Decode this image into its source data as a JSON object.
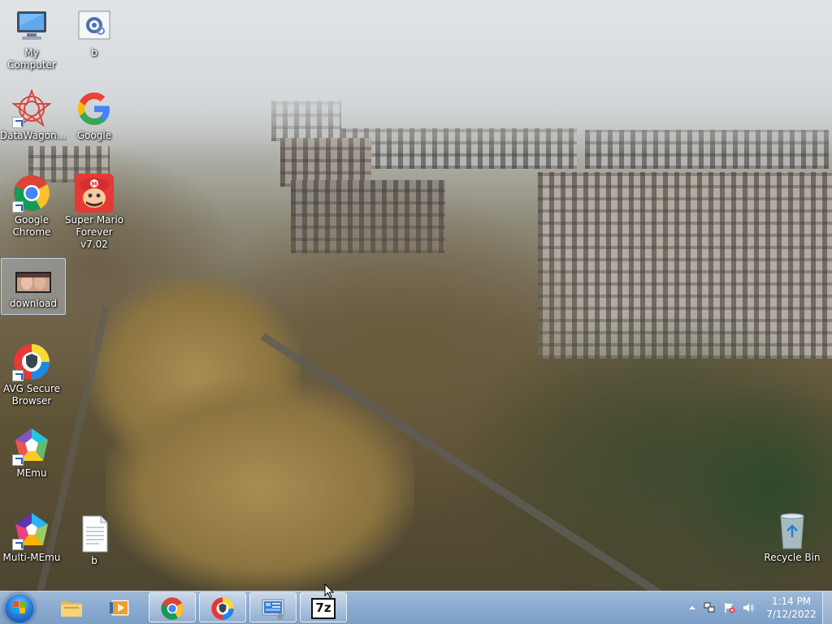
{
  "desktop": {
    "wallpaper": "city-ruins-foggy",
    "icons": [
      {
        "label": "My Computer",
        "icon": "computer-icon"
      },
      {
        "label": "b",
        "icon": "settings-file-icon"
      },
      {
        "label": "DataWagon...",
        "icon": "datawagon-icon"
      },
      {
        "label": "Google",
        "icon": "google-icon"
      },
      {
        "label": "Google Chrome",
        "icon": "chrome-icon"
      },
      {
        "label": "Super Mario Forever v7.02",
        "icon": "mario-icon"
      },
      {
        "label": "download",
        "icon": "image-file-icon"
      },
      {
        "label": "AVG Secure Browser",
        "icon": "avg-browser-icon"
      },
      {
        "label": "MEmu",
        "icon": "memu-icon"
      },
      {
        "label": "Multi-MEmu",
        "icon": "multi-memu-icon"
      },
      {
        "label": "b",
        "icon": "text-file-icon"
      },
      {
        "label": "Recycle Bin",
        "icon": "recycle-bin-icon"
      }
    ]
  },
  "taskbar": {
    "start": "start-button",
    "pinned": [
      {
        "name": "explorer",
        "icon": "folder-icon"
      },
      {
        "name": "media-player",
        "icon": "media-player-icon"
      },
      {
        "name": "chrome",
        "icon": "chrome-icon"
      },
      {
        "name": "avg-browser",
        "icon": "avg-browser-icon"
      },
      {
        "name": "control-panel",
        "icon": "control-panel-icon"
      },
      {
        "name": "7zip",
        "icon": "7zip-icon",
        "text": "7z"
      }
    ],
    "tray": {
      "time": "1:14 PM",
      "date": "7/12/2022"
    }
  },
  "colors": {
    "taskbar": "#8cabd0",
    "selection": "#c8dcf5"
  }
}
